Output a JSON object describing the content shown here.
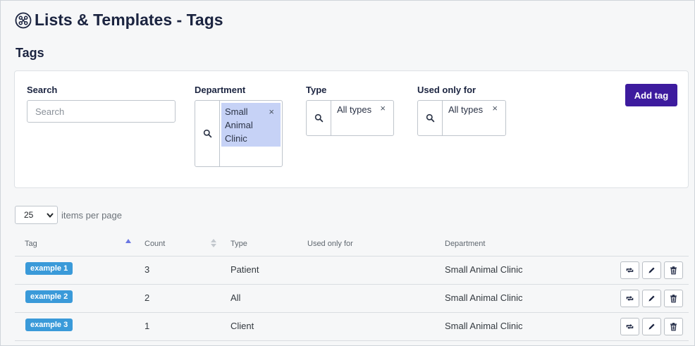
{
  "header": {
    "title": "Lists & Templates - Tags",
    "icon": "tags-module-icon"
  },
  "section": {
    "title": "Tags"
  },
  "filters": {
    "search": {
      "label": "Search",
      "placeholder": "Search",
      "value": ""
    },
    "department": {
      "label": "Department",
      "selected": "Small Animal Clinic",
      "icon": "search-icon"
    },
    "type": {
      "label": "Type",
      "selected": "All types",
      "icon": "search-icon"
    },
    "used_only_for": {
      "label": "Used only for",
      "selected": "All types",
      "icon": "search-icon"
    },
    "add_button": {
      "label": "Add tag"
    },
    "clear_symbol": "×"
  },
  "pagination": {
    "per_page": "25",
    "per_page_label": "items per page"
  },
  "table": {
    "columns": [
      "Tag",
      "Count",
      "Type",
      "Used only for",
      "Department"
    ],
    "rows": [
      {
        "tag": "example 1",
        "count": "3",
        "type": "Patient",
        "used_only_for": "",
        "department": "Small Animal Clinic"
      },
      {
        "tag": "example 2",
        "count": "2",
        "type": "All",
        "used_only_for": "",
        "department": "Small Animal Clinic"
      },
      {
        "tag": "example 3",
        "count": "1",
        "type": "Client",
        "used_only_for": "",
        "department": "Small Animal Clinic"
      }
    ],
    "row_action_icons": [
      "repeat-icon",
      "edit-pencil-icon",
      "trash-icon"
    ]
  },
  "colors": {
    "primary_button": "#3d1b9e",
    "tag_badge": "#3a9ad9",
    "selected_chip": "#c6d2f6",
    "sort_active": "#6b77e2"
  }
}
